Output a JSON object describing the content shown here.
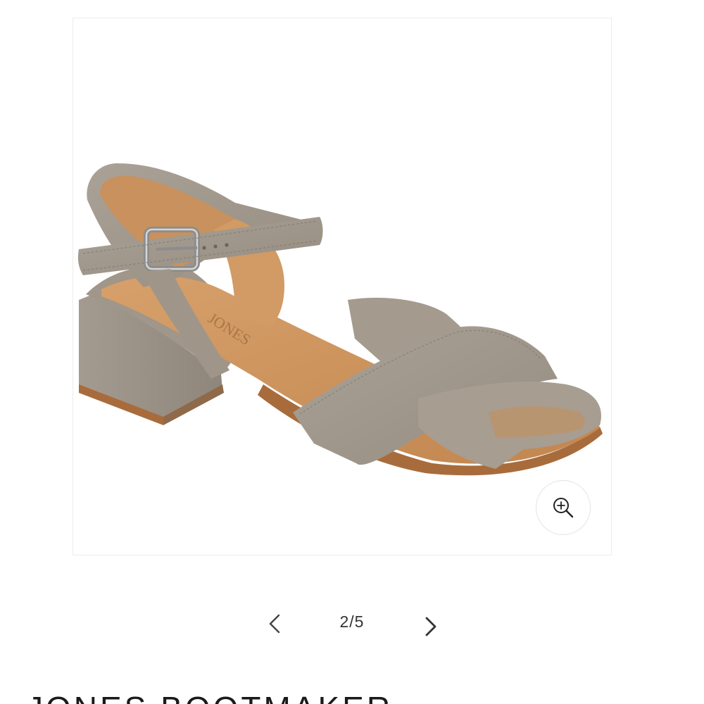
{
  "gallery": {
    "image_alt": "Taupe suede block-heel sandal with crossover straps and ankle buckle",
    "zoom_icon": "zoom-in-icon",
    "current_index": 2,
    "total": 5,
    "counter_text": "2/5",
    "prev_icon": "chevron-left-icon",
    "next_icon": "chevron-right-icon",
    "insole_text": "JONES"
  },
  "product": {
    "brand": "JONES BOOTMAKER"
  },
  "colors": {
    "suede": "#a39a8f",
    "insole": "#cb915c",
    "sole_edge": "#a86c3c"
  }
}
